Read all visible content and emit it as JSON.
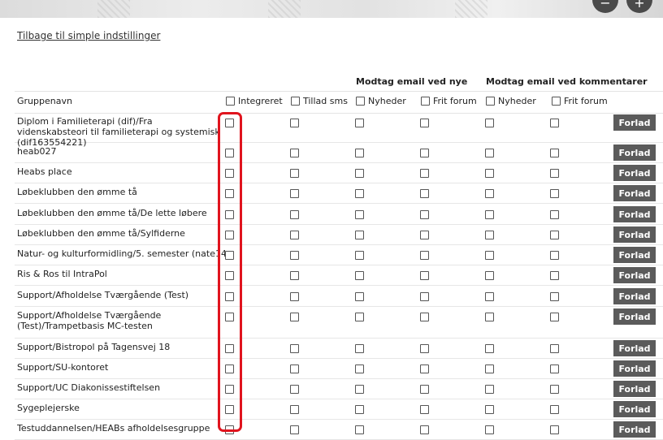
{
  "page": {
    "back_link": "Tilbage til simple indstillinger",
    "section_new": "Modtag email ved nye",
    "section_comments": "Modtag email ved kommentarer"
  },
  "header": {
    "group_name": "Gruppenavn",
    "integreret": "Integreret",
    "tillad_sms": "Tillad sms",
    "nyheder_new": "Nyheder",
    "frit_forum_new": "Frit forum",
    "nyheder_comments": "Nyheder",
    "frit_forum_comments": "Frit forum"
  },
  "leave_label": "Forlad",
  "groups": [
    {
      "name": "Diplom i Familieterapi (dif)/Fra videnskabsteori til familieterapi og systemisk (dif163554221)"
    },
    {
      "name": "heab027"
    },
    {
      "name": "Heabs place"
    },
    {
      "name": "Løbeklubben den ømme tå"
    },
    {
      "name": "Løbeklubben den ømme tå/De lette løbere"
    },
    {
      "name": "Løbeklubben den ømme tå/Sylfiderne"
    },
    {
      "name": "Natur- og kulturformidling/5. semester (nate14)"
    },
    {
      "name": "Ris & Ros til IntraPol"
    },
    {
      "name": "Support/Afholdelse Tværgående (Test)"
    },
    {
      "name": "Support/Afholdelse Tværgående (Test)/Trampetbasis MC-testen"
    },
    {
      "name": "Support/Bistropol på Tagensvej 18"
    },
    {
      "name": "Support/SU-kontoret"
    },
    {
      "name": "Support/UC Diakonissestiftelsen"
    },
    {
      "name": "Sygeplejerske"
    },
    {
      "name": "Testuddannelsen/HEABs afholdelsesgruppe"
    }
  ]
}
